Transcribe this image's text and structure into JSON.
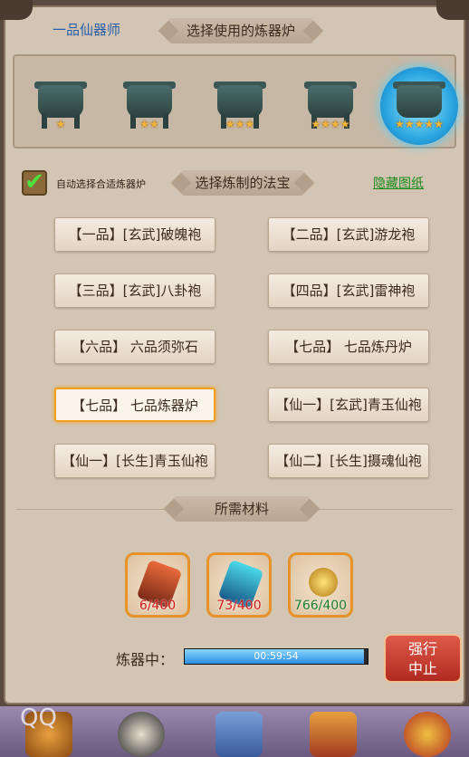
{
  "header": {
    "rank_title": "一品仙器师",
    "furnace_banner": "选择使用的炼器炉"
  },
  "furnaces": [
    {
      "stars": "★",
      "selected": false
    },
    {
      "stars": "★★",
      "selected": false
    },
    {
      "stars": "★★★",
      "selected": false
    },
    {
      "stars": "★★★★",
      "selected": false
    },
    {
      "stars": "★★★★★",
      "selected": true
    }
  ],
  "options": {
    "auto_select_label": "自动选择合适炼器炉",
    "auto_select_checked": true,
    "treasure_banner": "选择炼制的法宝",
    "hide_blueprint_link": "隐藏图纸"
  },
  "treasures": [
    {
      "label": "【一品】[玄武]破魄袍",
      "selected": false
    },
    {
      "label": "【二品】[玄武]游龙袍",
      "selected": false
    },
    {
      "label": "【三品】[玄武]八卦袍",
      "selected": false
    },
    {
      "label": "【四品】[玄武]雷神袍",
      "selected": false
    },
    {
      "label": "【六品】 六品须弥石",
      "selected": false
    },
    {
      "label": "【七品】 七品炼丹炉",
      "selected": false
    },
    {
      "label": "【七品】 七品炼器炉",
      "selected": true
    },
    {
      "label": "【仙一】[玄武]青玉仙袍",
      "selected": false
    },
    {
      "label": "【仙一】[长生]青玉仙袍",
      "selected": false
    },
    {
      "label": "【仙二】[长生]摄魂仙袍",
      "selected": false
    }
  ],
  "materials": {
    "banner": "所需材料",
    "items": [
      {
        "count": "6/400",
        "sufficient": false,
        "color": "#d0442a"
      },
      {
        "count": "73/400",
        "sufficient": false,
        "color": "#2aa6c0"
      },
      {
        "count": "766/400",
        "sufficient": true,
        "color": "#e0b030"
      }
    ]
  },
  "progress": {
    "label": "炼器中：",
    "time": "00:59:54",
    "fraction": 0.98
  },
  "stop_button": {
    "line1": "强行",
    "line2": "中止"
  },
  "watermark": "QQ"
}
